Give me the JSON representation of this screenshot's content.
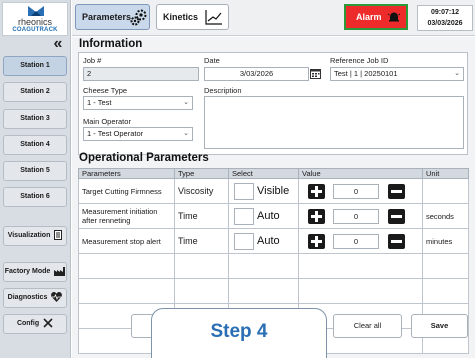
{
  "logo": {
    "name": "rheonics",
    "product": "COAGUTRACK"
  },
  "sidebar": {
    "collapse_label": "«",
    "stations": [
      {
        "label": "Station 1",
        "active": true
      },
      {
        "label": "Station 2",
        "active": false
      },
      {
        "label": "Station 3",
        "active": false
      },
      {
        "label": "Station 4",
        "active": false
      },
      {
        "label": "Station 5",
        "active": false
      },
      {
        "label": "Station 6",
        "active": false
      }
    ],
    "visualization_label": "Visualization",
    "factory_mode_label": "Factory Mode",
    "diagnostics_label": "Diagnostics",
    "config_label": "Config"
  },
  "topbar": {
    "parameters_tab": "Parameters",
    "kinetics_tab": "Kinetics",
    "alarm_label": "Alarm",
    "time": "09:07:12",
    "date": "03/03/2026"
  },
  "information": {
    "title": "Information",
    "job_label": "Job #",
    "job_value": "2",
    "date_label": "Date",
    "date_value": "3/03/2026",
    "ref_label": "Reference Job ID",
    "ref_value": "Test | 1 | 20250101",
    "cheese_label": "Cheese Type",
    "cheese_value": "1 - Test",
    "description_label": "Description",
    "description_value": "",
    "operator_label": "Main Operator",
    "operator_value": "1 - Test Operator"
  },
  "operational": {
    "title": "Operational Parameters",
    "columns": [
      "Parameters",
      "Type",
      "Select",
      "Value",
      "Unit"
    ],
    "rows": [
      {
        "parameter": "Target Cutting Firmness",
        "type": "Viscosity",
        "select": "Visible",
        "value": "0",
        "unit": ""
      },
      {
        "parameter": "Measurement initiation after renneting",
        "type": "Time",
        "select": "Auto",
        "value": "0",
        "unit": "seconds"
      },
      {
        "parameter": "Measurement stop alert",
        "type": "Time",
        "select": "Auto",
        "value": "0",
        "unit": "minutes"
      }
    ],
    "empty_rows": 4
  },
  "buttons": {
    "clear_all": "Clear all",
    "save": "Save"
  },
  "callout": {
    "label": "Step 4"
  },
  "colors": {
    "alarm_bg": "#ee2b2b",
    "alarm_border": "#2c9a3a",
    "active_tab": "#c9d8ea",
    "callout_text": "#2a6eb3"
  },
  "icons": {
    "parameters": "gears-icon",
    "kinetics": "line-chart-icon",
    "alarm": "alarm-bell-icon",
    "visualization": "document-icon",
    "factory_mode": "factory-icon",
    "diagnostics": "heart-pulse-icon",
    "config": "wrench-screwdriver-icon",
    "date_picker": "calendar-icon"
  }
}
